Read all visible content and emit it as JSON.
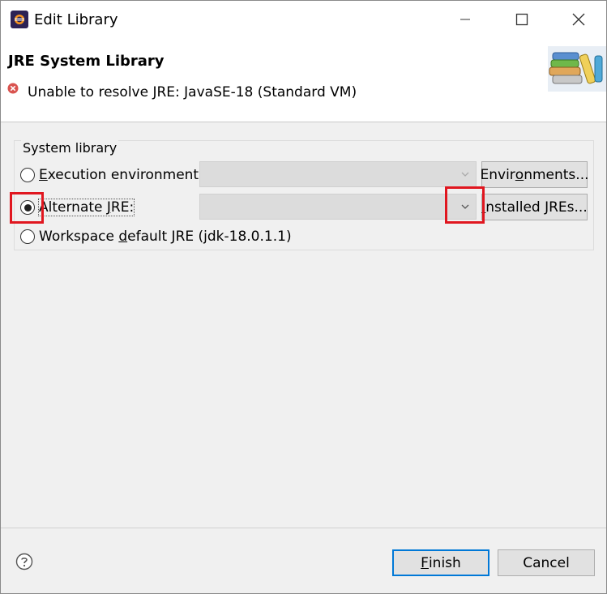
{
  "window": {
    "title": "Edit Library"
  },
  "header": {
    "title": "JRE System Library",
    "error_message": "Unable to resolve JRE: JavaSE-18 (Standard VM)"
  },
  "group": {
    "label": "System library",
    "options": [
      {
        "label_pre": "",
        "label_mnemonic": "E",
        "label_post": "xecution environment:",
        "selected": false
      },
      {
        "label_pre": "Alternate ",
        "label_mnemonic": "J",
        "label_post": "RE:",
        "selected": true
      },
      {
        "label_pre": "Workspace ",
        "label_mnemonic": "d",
        "label_post": "efault JRE (jdk-18.0.1.1)",
        "selected": false
      }
    ],
    "environments_button": {
      "pre": "Envir",
      "mnemonic": "o",
      "post": "nments..."
    },
    "installed_jres_button": {
      "pre": "",
      "mnemonic": "I",
      "post": "nstalled JREs..."
    }
  },
  "footer": {
    "finish_button": {
      "pre": "",
      "mnemonic": "F",
      "post": "inish"
    },
    "cancel_label": "Cancel"
  },
  "colors": {
    "highlight": "#e0161f",
    "default_button_border": "#0078d7"
  }
}
